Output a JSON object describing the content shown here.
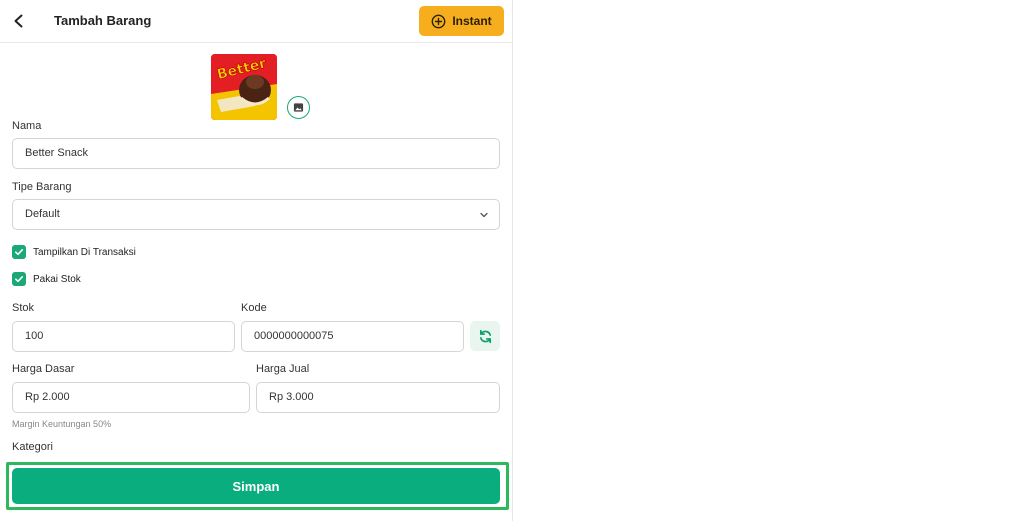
{
  "header": {
    "title": "Tambah Barang",
    "instant_label": "Instant"
  },
  "product": {
    "image_text": "Better"
  },
  "form": {
    "nama": {
      "label": "Nama",
      "value": "Better Snack"
    },
    "tipe": {
      "label": "Tipe Barang",
      "value": "Default"
    },
    "tampilkan": {
      "label": "Tampilkan Di Transaksi",
      "checked": true
    },
    "pakai_stok": {
      "label": "Pakai Stok",
      "checked": true
    },
    "stok": {
      "label": "Stok",
      "value": "100"
    },
    "kode": {
      "label": "Kode",
      "value": "0000000000075"
    },
    "harga_dasar": {
      "label": "Harga Dasar",
      "value": "Rp 2.000"
    },
    "harga_jual": {
      "label": "Harga Jual",
      "value": "Rp 3.000"
    },
    "margin_text": "Margin Keuntungan 50%",
    "kategori": {
      "label": "Kategori"
    }
  },
  "actions": {
    "save_label": "Simpan"
  },
  "colors": {
    "accent_green": "#09ad7e",
    "instant_orange": "#f7ae1e",
    "highlight_green": "#2eb85c"
  },
  "icons": {
    "back": "chevron-left-icon",
    "instant": "plus-circle-icon",
    "image_picker": "image-icon",
    "dropdown": "chevron-down-icon",
    "check": "check-icon",
    "refresh": "refresh-icon"
  }
}
